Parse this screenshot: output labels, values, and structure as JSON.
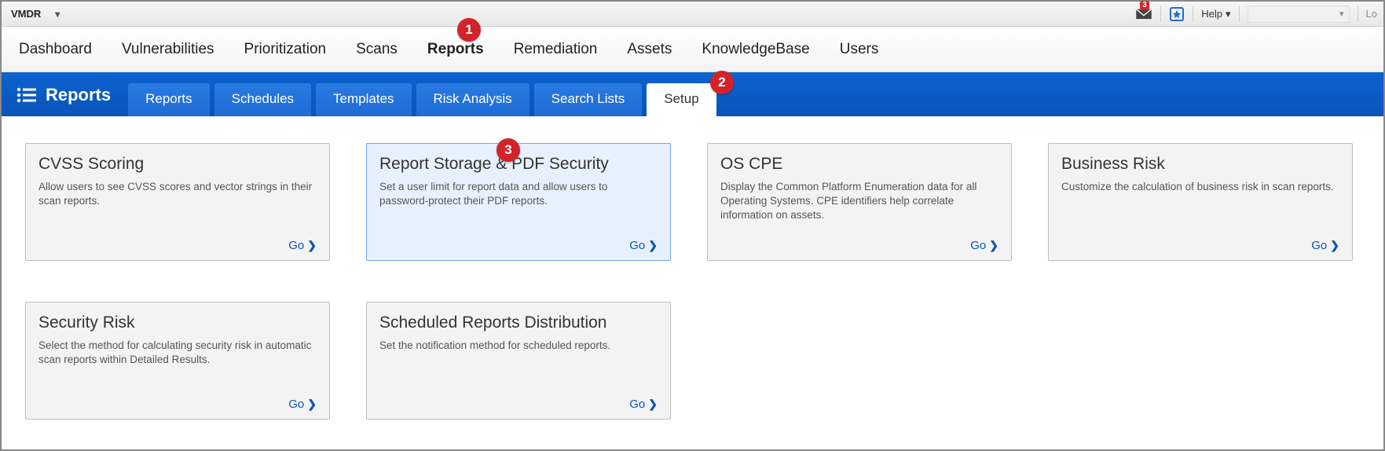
{
  "topbar": {
    "app_name": "VMDR",
    "mail_badge": "3",
    "help_label": "Help",
    "logout_hint": "Lo"
  },
  "mainnav": {
    "items": [
      {
        "label": "Dashboard"
      },
      {
        "label": "Vulnerabilities"
      },
      {
        "label": "Prioritization"
      },
      {
        "label": "Scans"
      },
      {
        "label": "Reports",
        "active": true
      },
      {
        "label": "Remediation"
      },
      {
        "label": "Assets"
      },
      {
        "label": "KnowledgeBase"
      },
      {
        "label": "Users"
      }
    ]
  },
  "subnav": {
    "section": "Reports",
    "tabs": [
      {
        "label": "Reports"
      },
      {
        "label": "Schedules"
      },
      {
        "label": "Templates"
      },
      {
        "label": "Risk Analysis"
      },
      {
        "label": "Search Lists"
      },
      {
        "label": "Setup",
        "active": true
      }
    ]
  },
  "cards": [
    {
      "title": "CVSS Scoring",
      "desc": "Allow users to see CVSS scores and vector strings in their scan reports.",
      "go": "Go"
    },
    {
      "title": "Report Storage & PDF Security",
      "desc": "Set a user limit for report data and allow users to password-protect their PDF reports.",
      "go": "Go",
      "highlight": true
    },
    {
      "title": "OS CPE",
      "desc": "Display the Common Platform Enumeration data for all Operating Systems. CPE identifiers help correlate information on assets.",
      "go": "Go"
    },
    {
      "title": "Business Risk",
      "desc": "Customize the calculation of business risk in scan reports.",
      "go": "Go"
    },
    {
      "title": "Security Risk",
      "desc": "Select the method for calculating security risk in automatic scan reports within Detailed Results.",
      "go": "Go"
    },
    {
      "title": "Scheduled Reports Distribution",
      "desc": "Set the notification method for scheduled reports.",
      "go": "Go"
    }
  ],
  "callouts": {
    "c1": "1",
    "c2": "2",
    "c3": "3"
  }
}
